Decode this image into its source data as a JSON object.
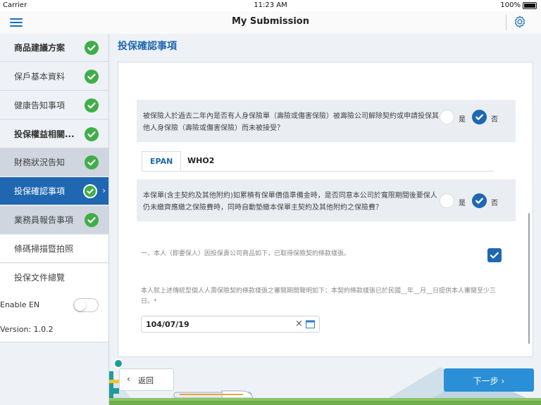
{
  "status_bar": {
    "carrier": "Carrier",
    "time": "11:23 AM",
    "battery": "100%"
  },
  "header": {
    "title": "My Submission",
    "menu_icon": "hamburger-icon",
    "settings_icon": "gear-icon"
  },
  "sidebar": {
    "items": [
      {
        "label": "商品建議方案",
        "done": true
      },
      {
        "label": "保戶基本資料",
        "done": true
      },
      {
        "label": "健康告知事項",
        "done": true
      },
      {
        "label": "投保權益相關...",
        "done": true
      },
      {
        "label": "財務狀況告知",
        "done": true
      },
      {
        "label": "投保確認事項",
        "done": true
      },
      {
        "label": "業務員報告事項",
        "done": true
      },
      {
        "label": "條碼掃描暨拍照",
        "done": false
      },
      {
        "label": "投保文件總覽",
        "done": false
      }
    ],
    "enable_label": "Enable EN",
    "enable_on": false,
    "version": "Version: 1.0.2"
  },
  "main": {
    "title": "投保確認事項",
    "question1": {
      "text": "被保險人於過去二年內是否有人身保險單（壽險或傷害保險）被壽險公司解除契約或申請投保其他人身保險（壽險或傷害保險）而未被接受？",
      "yes": "是",
      "no": "否",
      "selected": "否"
    },
    "tabs": [
      "EPAN",
      "WHO2"
    ],
    "active_tab": "EPAN",
    "question2": {
      "text": "本保單(含主契約及其他附約)如累積有保單價值準備金時，是否同意本公司於寬限期間後要保人仍未繳齊應繳之保險費時，同時自動墊繳本保單主契約及其他附約之保險費？",
      "yes": "是",
      "no": "否",
      "selected": "否"
    },
    "statement1": "一、本人（即要保人）因投保貴公司商品如下，已取得保險契約條款樣張。",
    "statement1_checked": true,
    "statement2": "本人就上述傳統型個人人壽保險契約條款樣張之審閱期間聲明如下：本契約條款樣張已於民國__年__月__日提供本人審閱至少三日。*",
    "date_value": "104/07/19"
  },
  "footer": {
    "back_label": "返回",
    "next_label": "下一步"
  },
  "colors": {
    "primary": "#1f67b1",
    "success": "#3fae49",
    "next_button": "#2a8fd6"
  }
}
